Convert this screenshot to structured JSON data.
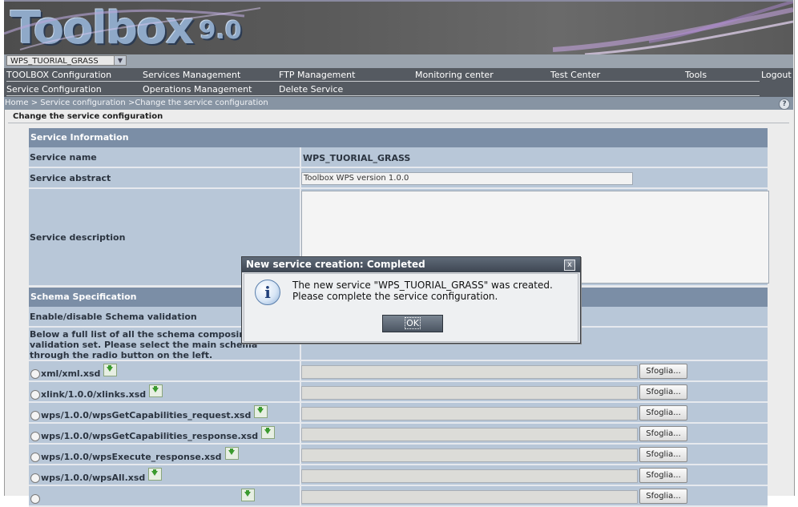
{
  "header": {
    "logo_text": "Toolbox",
    "logo_version": "9.0",
    "service_selector": "WPS_TUORIAL_GRASS"
  },
  "menu": {
    "row1": [
      "TOOLBOX Configuration",
      "Services Management",
      "FTP Management",
      "Monitoring center",
      "Test Center",
      "Tools",
      "Logout"
    ],
    "row2": [
      "Service Configuration",
      "Operations Management",
      "Delete Service"
    ]
  },
  "breadcrumb": {
    "home": "Home",
    "sep1": " > ",
    "level1": "Service configuration",
    "sep2": " >",
    "current": "Change the service configuration",
    "help": "?"
  },
  "page_title": "Change the service configuration",
  "service_info": {
    "section_title": "Service Information",
    "name_label": "Service name",
    "name_value": "WPS_TUORIAL_GRASS",
    "abstract_label": "Service abstract",
    "abstract_value": "Toolbox WPS version 1.0.0",
    "description_label": "Service description",
    "description_value": ""
  },
  "schema": {
    "section_title": "Schema Specification",
    "validation_label": "Enable/disable Schema validation",
    "list_label": "Below a full list of all the schema composing the validation set. Please select the main schema through the radio button on the left.",
    "browse_label": "Sfoglia...",
    "files": [
      "xml/xml.xsd",
      "xlink/1.0.0/xlinks.xsd",
      "wps/1.0.0/wpsGetCapabilities_request.xsd",
      "wps/1.0.0/wpsGetCapabilities_response.xsd",
      "wps/1.0.0/wpsExecute_response.xsd",
      "wps/1.0.0/wpsAll.xsd",
      ""
    ]
  },
  "dialog": {
    "title": "New service creation: Completed",
    "close": "x",
    "icon": "i",
    "line1": "The new service \"WPS_TUORIAL_GRASS\" was created.",
    "line2": "Please complete the service configuration.",
    "ok": "OK"
  }
}
